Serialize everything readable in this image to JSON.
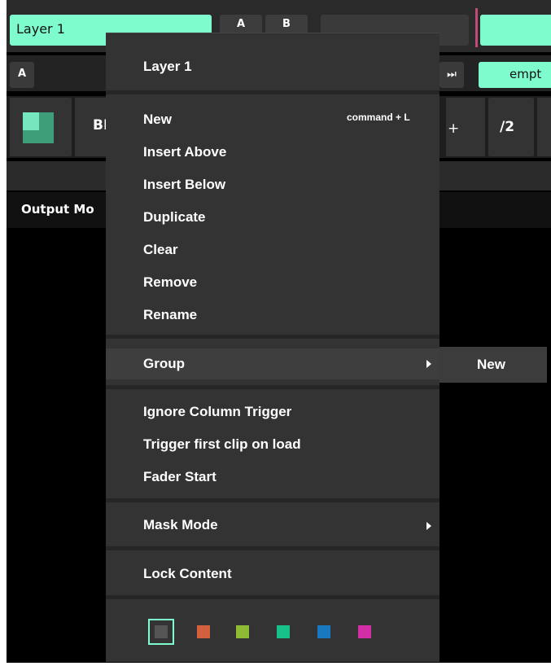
{
  "header": {
    "layer_name": "Layer 1",
    "button_a": "A",
    "button_b": "B",
    "row2_a": "A",
    "row2_next": "⏭",
    "clip_label": "empt"
  },
  "controls": {
    "blend_label": "BF",
    "plus_label": "+",
    "divide_label": "/2"
  },
  "output": {
    "label": "Output Mo"
  },
  "menu": {
    "title": "Layer 1",
    "items_section1": [
      {
        "label": "New",
        "shortcut": "command + L"
      },
      {
        "label": "Insert Above"
      },
      {
        "label": "Insert Below"
      },
      {
        "label": "Duplicate"
      },
      {
        "label": "Clear"
      },
      {
        "label": "Remove"
      },
      {
        "label": "Rename"
      }
    ],
    "group": {
      "label": "Group",
      "submenu": [
        "New"
      ]
    },
    "items_section3": [
      {
        "label": "Ignore Column Trigger"
      },
      {
        "label": "Trigger first clip on load"
      },
      {
        "label": "Fader Start"
      }
    ],
    "mask_mode": "Mask Mode",
    "lock_content": "Lock Content",
    "colors": [
      {
        "name": "gray",
        "hex": "#555555",
        "selected": true
      },
      {
        "name": "orange",
        "hex": "#d2603f"
      },
      {
        "name": "lime",
        "hex": "#8dbb34"
      },
      {
        "name": "teal",
        "hex": "#18c08a"
      },
      {
        "name": "blue",
        "hex": "#1a78c0"
      },
      {
        "name": "magenta",
        "hex": "#d22ea6"
      }
    ]
  }
}
